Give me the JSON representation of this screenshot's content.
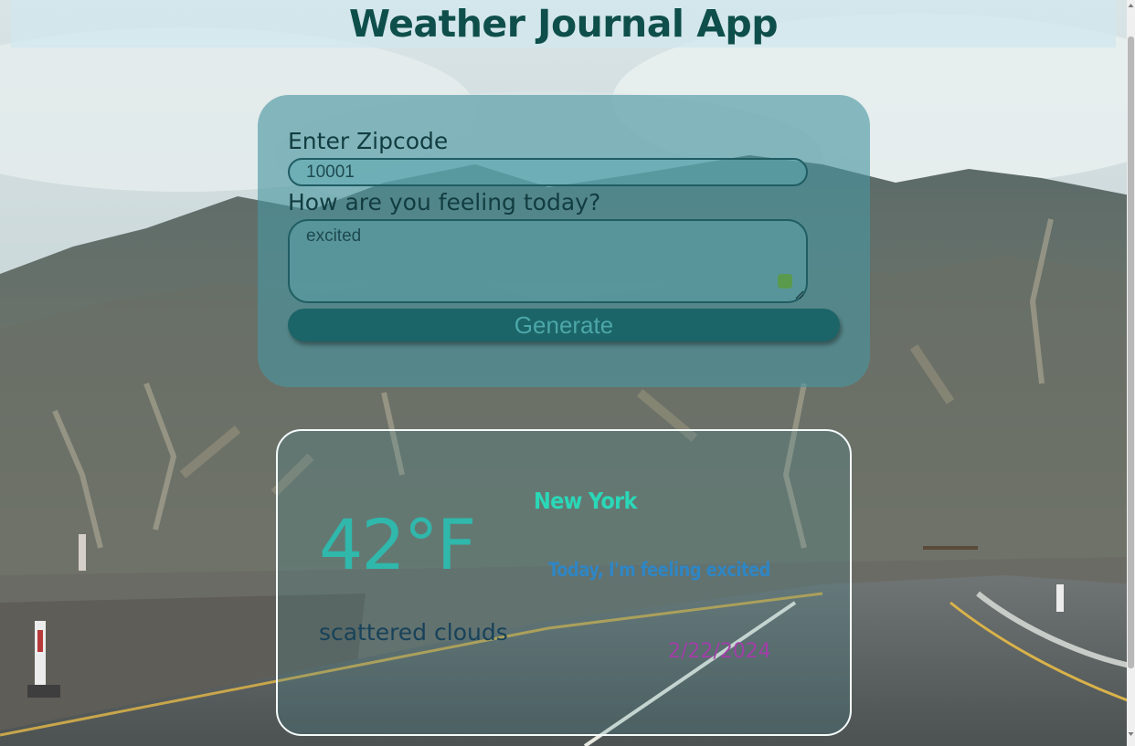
{
  "app": {
    "title": "Weather Journal App"
  },
  "form": {
    "zip_label": "Enter Zipcode",
    "zip_value": "10001",
    "feelings_label": "How are you feeling today?",
    "feelings_value": "excited",
    "generate_label": "Generate"
  },
  "entry": {
    "temperature": "42°F",
    "city": "New York",
    "feeling": "Today, I'm feeling excited",
    "description": "scattered clouds",
    "date": "2/22/2024"
  },
  "colors": {
    "title": "#0f4f4b",
    "button": "#1b6468",
    "temperature": "#2fb8ab",
    "city": "#2ad8b8",
    "feeling": "#2f86c4",
    "date": "#a13fa8"
  },
  "icons": {
    "resize_grip": "resize-grip-icon",
    "grammar_indicator": "grammar-check-icon"
  }
}
